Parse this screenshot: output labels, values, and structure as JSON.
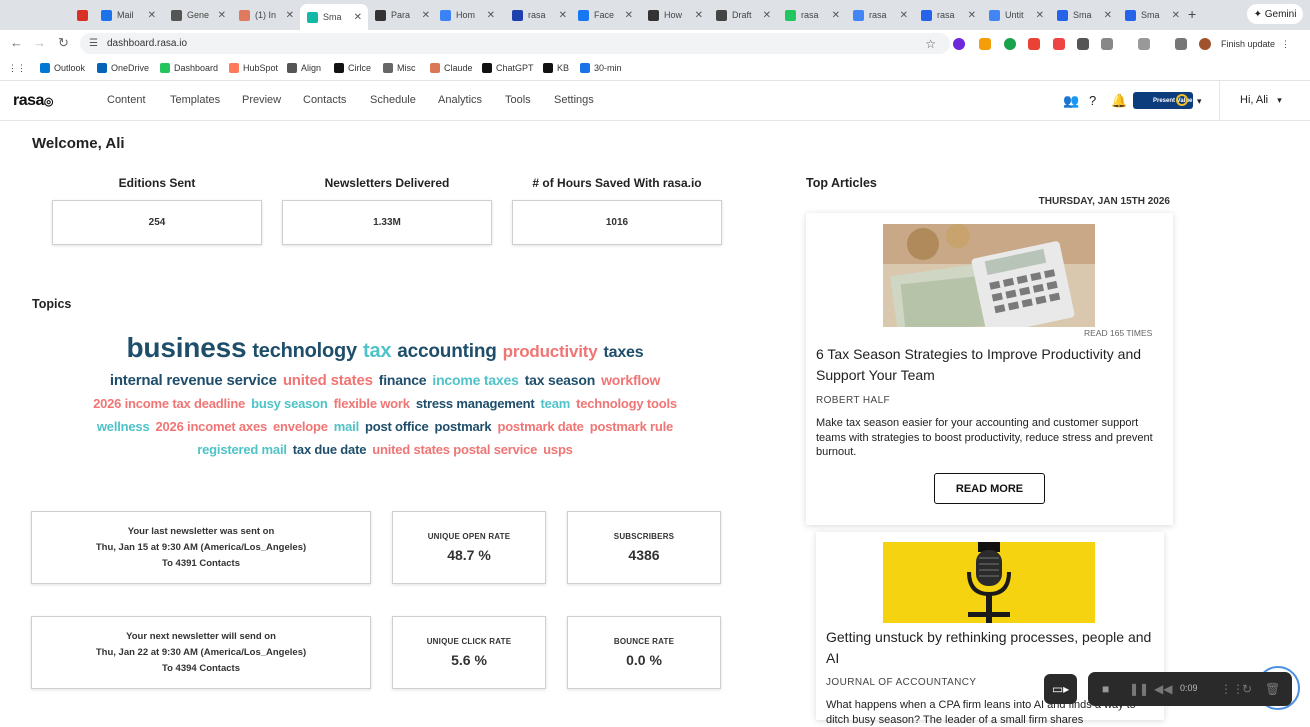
{
  "browser": {
    "tabs": [
      {
        "label": "",
        "color": "#d93025"
      },
      {
        "label": "Mail",
        "color": "#1a73e8"
      },
      {
        "label": "Gene",
        "color": "#555555"
      },
      {
        "label": "(1) In",
        "color": "#e07a5f"
      },
      {
        "label": "Sma",
        "color": "#14b8a6"
      },
      {
        "label": "Para",
        "color": "#333333"
      },
      {
        "label": "Hom",
        "color": "#3b82f6"
      },
      {
        "label": "rasa",
        "color": "#1e40af"
      },
      {
        "label": "Face",
        "color": "#1877f2"
      },
      {
        "label": "How",
        "color": "#333333"
      },
      {
        "label": "Draft",
        "color": "#444444"
      },
      {
        "label": "rasa",
        "color": "#22c55e"
      },
      {
        "label": "rasa",
        "color": "#4285f4"
      },
      {
        "label": "rasa",
        "color": "#2563eb"
      },
      {
        "label": "Untit",
        "color": "#4285f4"
      },
      {
        "label": "Sma",
        "color": "#2563eb"
      },
      {
        "label": "Sma",
        "color": "#2563eb"
      }
    ],
    "gemini_label": "Gemini",
    "url": "dashboard.rasa.io",
    "finish_update_label": "Finish update",
    "bookmarks": [
      {
        "label": "Outlook",
        "color": "#0078d4"
      },
      {
        "label": "OneDrive",
        "color": "#0364b8"
      },
      {
        "label": "Dashboard",
        "color": "#22c55e"
      },
      {
        "label": "HubSpot",
        "color": "#ff7a59"
      },
      {
        "label": "Align",
        "color": "#555555"
      },
      {
        "label": "Cirlce",
        "color": "#111111"
      },
      {
        "label": "Misc",
        "color": "#666666"
      },
      {
        "label": "Claude",
        "color": "#d97757"
      },
      {
        "label": "ChatGPT",
        "color": "#111111"
      },
      {
        "label": "KB",
        "color": "#111111"
      },
      {
        "label": "30-min",
        "color": "#1a73e8"
      }
    ]
  },
  "app": {
    "logo": "rasa",
    "nav": [
      "Content",
      "Templates",
      "Preview",
      "Contacts",
      "Schedule",
      "Analytics",
      "Tools",
      "Settings"
    ],
    "badge_text": "Present Value",
    "greeting": "Hi, Ali"
  },
  "dashboard": {
    "welcome": "Welcome, Ali",
    "stats": [
      {
        "title": "Editions Sent",
        "value": "254"
      },
      {
        "title": "Newsletters Delivered",
        "value": "1.33M"
      },
      {
        "title": "# of Hours Saved With rasa.io",
        "value": "1016"
      }
    ],
    "topics_heading": "Topics",
    "topics": [
      [
        {
          "text": "business",
          "color": "#1f4e6b",
          "size": 28
        },
        {
          "text": "technology",
          "color": "#1f4e6b",
          "size": 20
        },
        {
          "text": "tax",
          "color": "#4fc3c7",
          "size": 20
        },
        {
          "text": "accounting",
          "color": "#1f4e6b",
          "size": 19
        },
        {
          "text": "productivity",
          "color": "#f07575",
          "size": 17
        },
        {
          "text": "taxes",
          "color": "#1f4e6b",
          "size": 16
        }
      ],
      [
        {
          "text": "internal revenue service",
          "color": "#1f4e6b",
          "size": 15
        },
        {
          "text": "united states",
          "color": "#f07575",
          "size": 15
        },
        {
          "text": "finance",
          "color": "#1f4e6b",
          "size": 14
        },
        {
          "text": "income taxes",
          "color": "#4fc3c7",
          "size": 14
        },
        {
          "text": "tax season",
          "color": "#1f4e6b",
          "size": 14
        },
        {
          "text": "workflow",
          "color": "#f07575",
          "size": 14
        }
      ],
      [
        {
          "text": "2026 income tax deadline",
          "color": "#f07575",
          "size": 13
        },
        {
          "text": "busy season",
          "color": "#4fc3c7",
          "size": 13
        },
        {
          "text": "flexible work",
          "color": "#f07575",
          "size": 13
        },
        {
          "text": "stress management",
          "color": "#1f4e6b",
          "size": 13
        },
        {
          "text": "team",
          "color": "#4fc3c7",
          "size": 13
        },
        {
          "text": "technology tools",
          "color": "#f07575",
          "size": 13
        }
      ],
      [
        {
          "text": "wellness",
          "color": "#4fc3c7",
          "size": 13
        },
        {
          "text": "2026 incomet axes",
          "color": "#f07575",
          "size": 13
        },
        {
          "text": "envelope",
          "color": "#f07575",
          "size": 13
        },
        {
          "text": "mail",
          "color": "#4fc3c7",
          "size": 13
        },
        {
          "text": "post office",
          "color": "#1f4e6b",
          "size": 13
        },
        {
          "text": "postmark",
          "color": "#1f4e6b",
          "size": 13
        },
        {
          "text": "postmark date",
          "color": "#f07575",
          "size": 13
        },
        {
          "text": "postmark rule",
          "color": "#f07575",
          "size": 13
        }
      ],
      [
        {
          "text": "registered mail",
          "color": "#4fc3c7",
          "size": 13
        },
        {
          "text": "tax due date",
          "color": "#1f4e6b",
          "size": 13
        },
        {
          "text": "united states postal service",
          "color": "#f07575",
          "size": 13
        },
        {
          "text": "usps",
          "color": "#f07575",
          "size": 13
        }
      ]
    ],
    "last_newsletter": {
      "line1": "Your last newsletter was sent on",
      "line2": "Thu, Jan 15 at 9:30 AM (America/Los_Angeles)",
      "line3": "To 4391 Contacts"
    },
    "next_newsletter": {
      "line1": "Your next newsletter will send on",
      "line2": "Thu, Jan 22 at 9:30 AM (America/Los_Angeles)",
      "line3": "To 4394 Contacts"
    },
    "kpis": {
      "open_rate": {
        "label": "UNIQUE OPEN RATE",
        "value": "48.7 %"
      },
      "subscribers": {
        "label": "SUBSCRIBERS",
        "value": "4386"
      },
      "click_rate": {
        "label": "UNIQUE CLICK RATE",
        "value": "5.6 %"
      },
      "bounce_rate": {
        "label": "BOUNCE RATE",
        "value": "0.0 %"
      }
    }
  },
  "top_articles": {
    "heading": "Top Articles",
    "date": "THURSDAY, JAN 15TH 2026",
    "articles": [
      {
        "read_times": "READ 165 TIMES",
        "title": "6 Tax Season Strategies to Improve Productivity and Support Your Team",
        "source": "ROBERT HALF",
        "description": "Make tax season easier for your accounting and customer support teams with strategies to boost productivity, reduce stress and prevent burnout.",
        "button": "READ MORE"
      },
      {
        "title": "Getting unstuck by rethinking processes, people and AI",
        "source": "JOURNAL OF ACCOUNTANCY",
        "description": "What happens when a CPA firm leans into AI and finds a way to ditch busy season? The leader of a small firm shares"
      }
    ]
  },
  "recorder": {
    "time": "0:09"
  }
}
